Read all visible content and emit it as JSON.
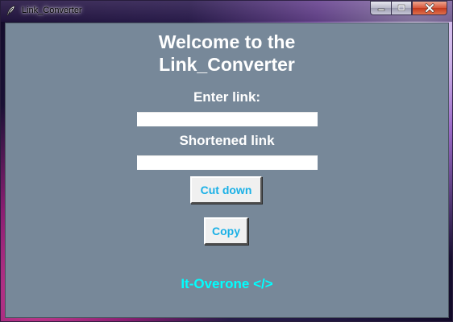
{
  "window": {
    "title": "Link_Converter",
    "app_icon": "feather-icon",
    "caption_buttons": [
      "minimize-icon",
      "maximize-icon",
      "close-icon"
    ]
  },
  "main": {
    "heading": "Welcome to the\nLink_Converter",
    "enter_link_label": "Enter link:",
    "enter_link_value": "",
    "shortened_label": "Shortened link",
    "shortened_value": "",
    "cut_down_button": "Cut down",
    "copy_button": "Copy",
    "footer": "It-Overone </>"
  },
  "colors": {
    "background": "#778899",
    "text": "#ffffff",
    "button_text": "#1ab0e6",
    "footer_text": "#00ffff"
  }
}
